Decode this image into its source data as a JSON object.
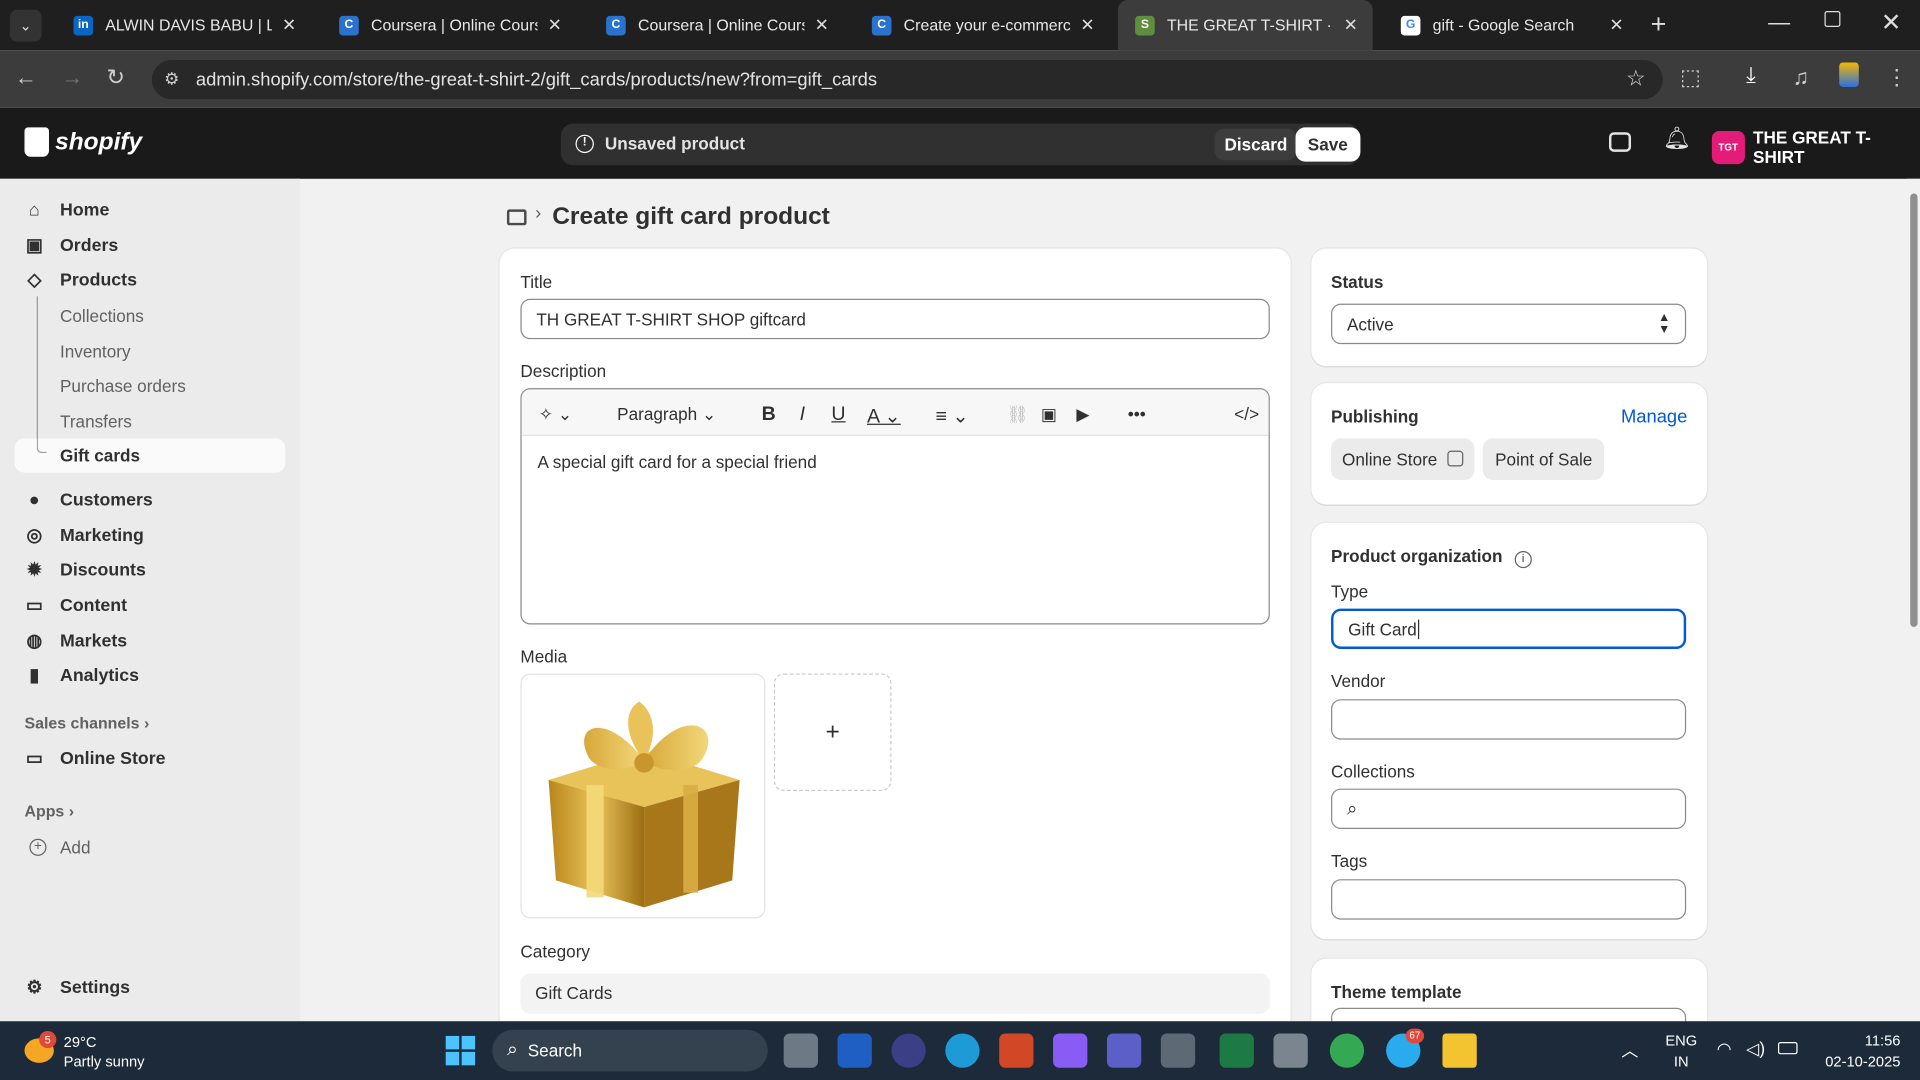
{
  "browser": {
    "tabs": [
      {
        "title": "ALWIN DAVIS BABU | Linke",
        "icon": "linkedin-icon",
        "color": "#0a66c2",
        "glyph": "in"
      },
      {
        "title": "Coursera | Online Courses",
        "icon": "coursera-icon",
        "color": "#2a73cc",
        "glyph": "C"
      },
      {
        "title": "Coursera | Online Courses",
        "icon": "coursera-icon",
        "color": "#2a73cc",
        "glyph": "C"
      },
      {
        "title": "Create your e-commerce s",
        "icon": "coursera-icon",
        "color": "#2a73cc",
        "glyph": "C"
      },
      {
        "title": "THE GREAT T-SHIRT · Gift c",
        "icon": "shopify-icon",
        "color": "#5e8e3e",
        "glyph": "S"
      },
      {
        "title": "gift - Google Search",
        "icon": "google-icon",
        "color": "#ffffff",
        "glyph": "G"
      }
    ],
    "url": "admin.shopify.com/store/the-great-t-shirt-2/gift_cards/products/new?from=gift_cards"
  },
  "topbar": {
    "logo": "shopify",
    "unsaved": "Unsaved product",
    "discard": "Discard",
    "save": "Save",
    "store_initials": "TGT",
    "store_name": "THE GREAT T-SHIRT"
  },
  "sidebar": {
    "home": "Home",
    "orders": "Orders",
    "products": "Products",
    "collections": "Collections",
    "inventory": "Inventory",
    "purchase_orders": "Purchase orders",
    "transfers": "Transfers",
    "gift_cards": "Gift cards",
    "customers": "Customers",
    "marketing": "Marketing",
    "discounts": "Discounts",
    "content": "Content",
    "markets": "Markets",
    "analytics": "Analytics",
    "sales_channels": "Sales channels",
    "online_store": "Online Store",
    "apps": "Apps",
    "add": "Add",
    "settings": "Settings"
  },
  "page": {
    "title": "Create gift card product",
    "title_label": "Title",
    "title_value": "TH GREAT T-SHIRT SHOP giftcard",
    "description_label": "Description",
    "paragraph": "Paragraph",
    "description_value": "A special gift card for a special friend",
    "media_label": "Media",
    "add_media": "+",
    "category_label": "Category",
    "category_value": "Gift Cards"
  },
  "side_panel": {
    "status_label": "Status",
    "status_value": "Active",
    "publishing_label": "Publishing",
    "manage": "Manage",
    "channel_1": "Online Store",
    "channel_2": "Point of Sale",
    "org_label": "Product organization",
    "type_label": "Type",
    "type_value": "Gift Card",
    "vendor_label": "Vendor",
    "vendor_value": "",
    "collections_label": "Collections",
    "tags_label": "Tags",
    "theme_label": "Theme template"
  },
  "taskbar": {
    "temp": "29°C",
    "weather": "Partly sunny",
    "weather_badge": "5",
    "search": "Search",
    "lang1": "ENG",
    "lang2": "IN",
    "time": "11:56",
    "date": "02-10-2025",
    "telegram_badge": "67"
  }
}
